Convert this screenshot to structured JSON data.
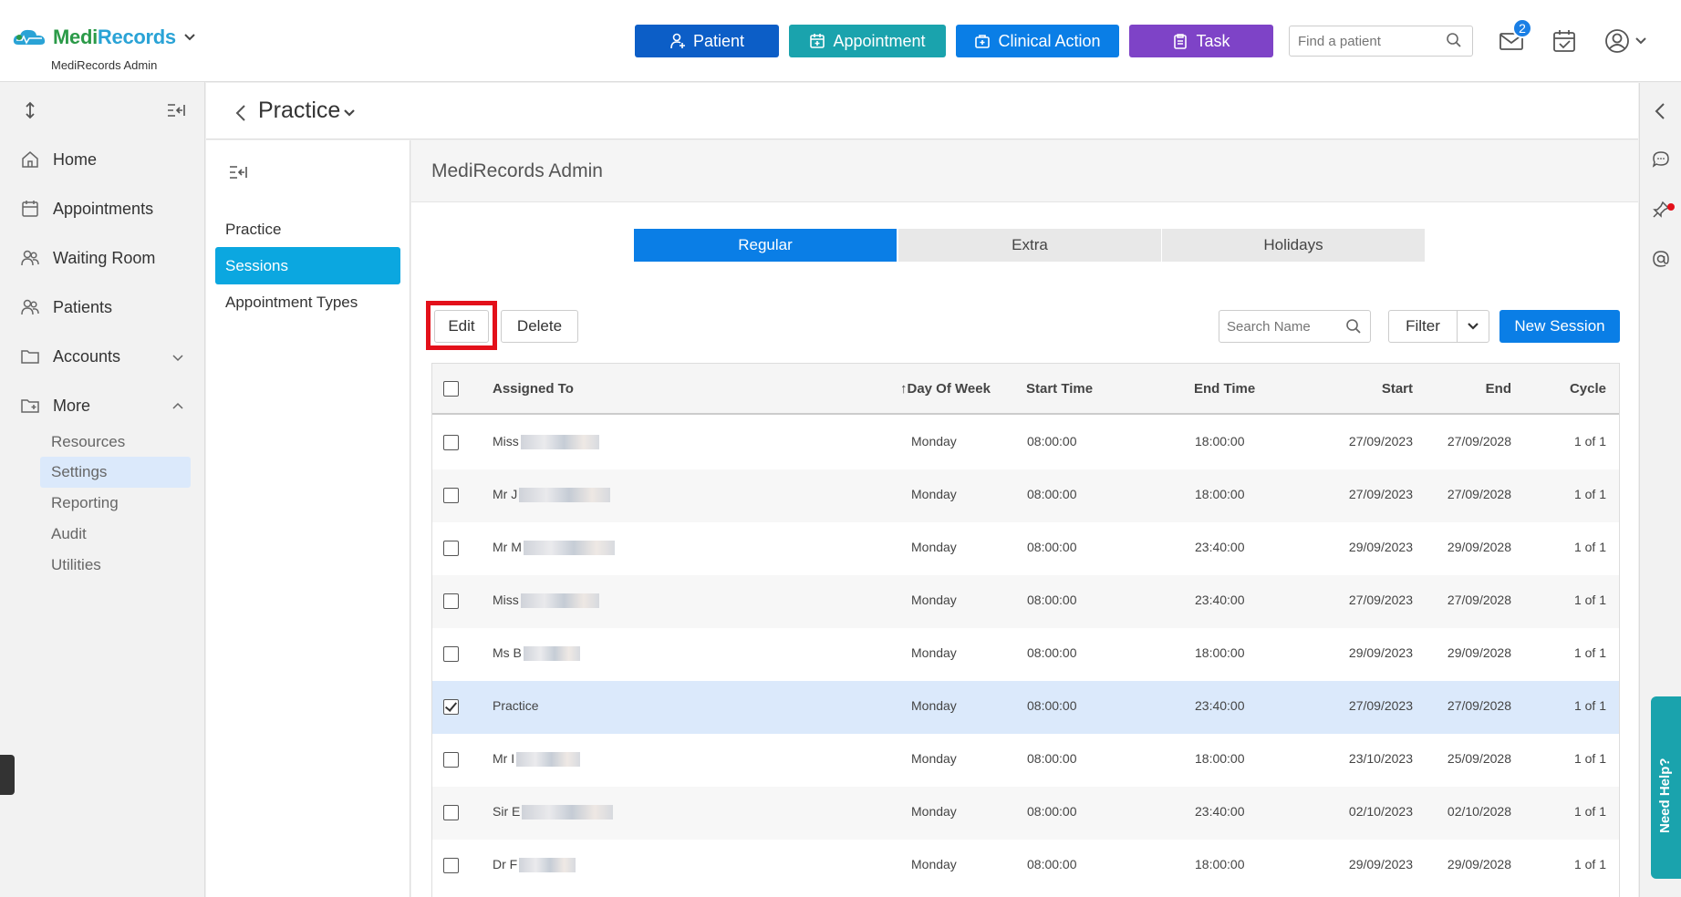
{
  "brand": {
    "name_part1": "Medi",
    "name_part2": "Records",
    "subtitle": "MediRecords Admin"
  },
  "header": {
    "buttons": {
      "patient": "Patient",
      "appointment": "Appointment",
      "clinical_action": "Clinical Action",
      "task": "Task"
    },
    "search_placeholder": "Find a patient",
    "mail_badge": "2"
  },
  "sidebar": {
    "items": [
      {
        "label": "Home"
      },
      {
        "label": "Appointments"
      },
      {
        "label": "Waiting Room"
      },
      {
        "label": "Patients"
      },
      {
        "label": "Accounts"
      },
      {
        "label": "More"
      }
    ],
    "more_subitems": [
      {
        "label": "Resources"
      },
      {
        "label": "Settings",
        "active": true
      },
      {
        "label": "Reporting"
      },
      {
        "label": "Audit"
      },
      {
        "label": "Utilities"
      }
    ]
  },
  "page": {
    "title": "Practice"
  },
  "submenu": {
    "items": [
      {
        "label": "Practice"
      },
      {
        "label": "Sessions",
        "active": true
      },
      {
        "label": "Appointment Types"
      }
    ]
  },
  "main": {
    "title": "MediRecords Admin",
    "tabs": [
      {
        "label": "Regular",
        "active": true
      },
      {
        "label": "Extra"
      },
      {
        "label": "Holidays"
      }
    ],
    "actions": {
      "edit": "Edit",
      "delete": "Delete",
      "search_placeholder": "Search Name",
      "filter": "Filter",
      "new_session": "New Session"
    }
  },
  "table": {
    "columns": {
      "assigned_to": "Assigned To",
      "day_of_week": "↑Day Of Week",
      "start_time": "Start Time",
      "end_time": "End Time",
      "start": "Start",
      "end": "End",
      "cycle": "Cycle"
    },
    "rows": [
      {
        "assigned": "Miss",
        "day": "Monday",
        "start_time": "08:00:00",
        "end_time": "18:00:00",
        "start": "27/09/2023",
        "end": "27/09/2028",
        "cycle": "1 of 1",
        "checked": false
      },
      {
        "assigned": "Mr J",
        "day": "Monday",
        "start_time": "08:00:00",
        "end_time": "18:00:00",
        "start": "27/09/2023",
        "end": "27/09/2028",
        "cycle": "1 of 1",
        "checked": false
      },
      {
        "assigned": "Mr M",
        "day": "Monday",
        "start_time": "08:00:00",
        "end_time": "23:40:00",
        "start": "29/09/2023",
        "end": "29/09/2028",
        "cycle": "1 of 1",
        "checked": false
      },
      {
        "assigned": "Miss",
        "day": "Monday",
        "start_time": "08:00:00",
        "end_time": "23:40:00",
        "start": "27/09/2023",
        "end": "27/09/2028",
        "cycle": "1 of 1",
        "checked": false
      },
      {
        "assigned": "Ms B",
        "day": "Monday",
        "start_time": "08:00:00",
        "end_time": "18:00:00",
        "start": "29/09/2023",
        "end": "29/09/2028",
        "cycle": "1 of 1",
        "checked": false
      },
      {
        "assigned": "Practice",
        "day": "Monday",
        "start_time": "08:00:00",
        "end_time": "23:40:00",
        "start": "27/09/2023",
        "end": "27/09/2028",
        "cycle": "1 of 1",
        "checked": true
      },
      {
        "assigned": "Mr I",
        "day": "Monday",
        "start_time": "08:00:00",
        "end_time": "18:00:00",
        "start": "23/10/2023",
        "end": "25/09/2028",
        "cycle": "1 of 1",
        "checked": false
      },
      {
        "assigned": "Sir E",
        "day": "Monday",
        "start_time": "08:00:00",
        "end_time": "23:40:00",
        "start": "02/10/2023",
        "end": "02/10/2028",
        "cycle": "1 of 1",
        "checked": false
      },
      {
        "assigned": "Dr F",
        "day": "Monday",
        "start_time": "08:00:00",
        "end_time": "18:00:00",
        "start": "29/09/2023",
        "end": "29/09/2028",
        "cycle": "1 of 1",
        "checked": false
      }
    ]
  },
  "help": {
    "label": "Need Help?"
  },
  "colors": {
    "patient_btn": "#0c5ec7",
    "appointment_btn": "#1aa3ad",
    "clinical_btn": "#0a7ee6",
    "task_btn": "#7e43c7",
    "active_tab": "#0a7ee6",
    "active_submenu": "#0ba7e0",
    "highlight_box": "#e3101a"
  }
}
